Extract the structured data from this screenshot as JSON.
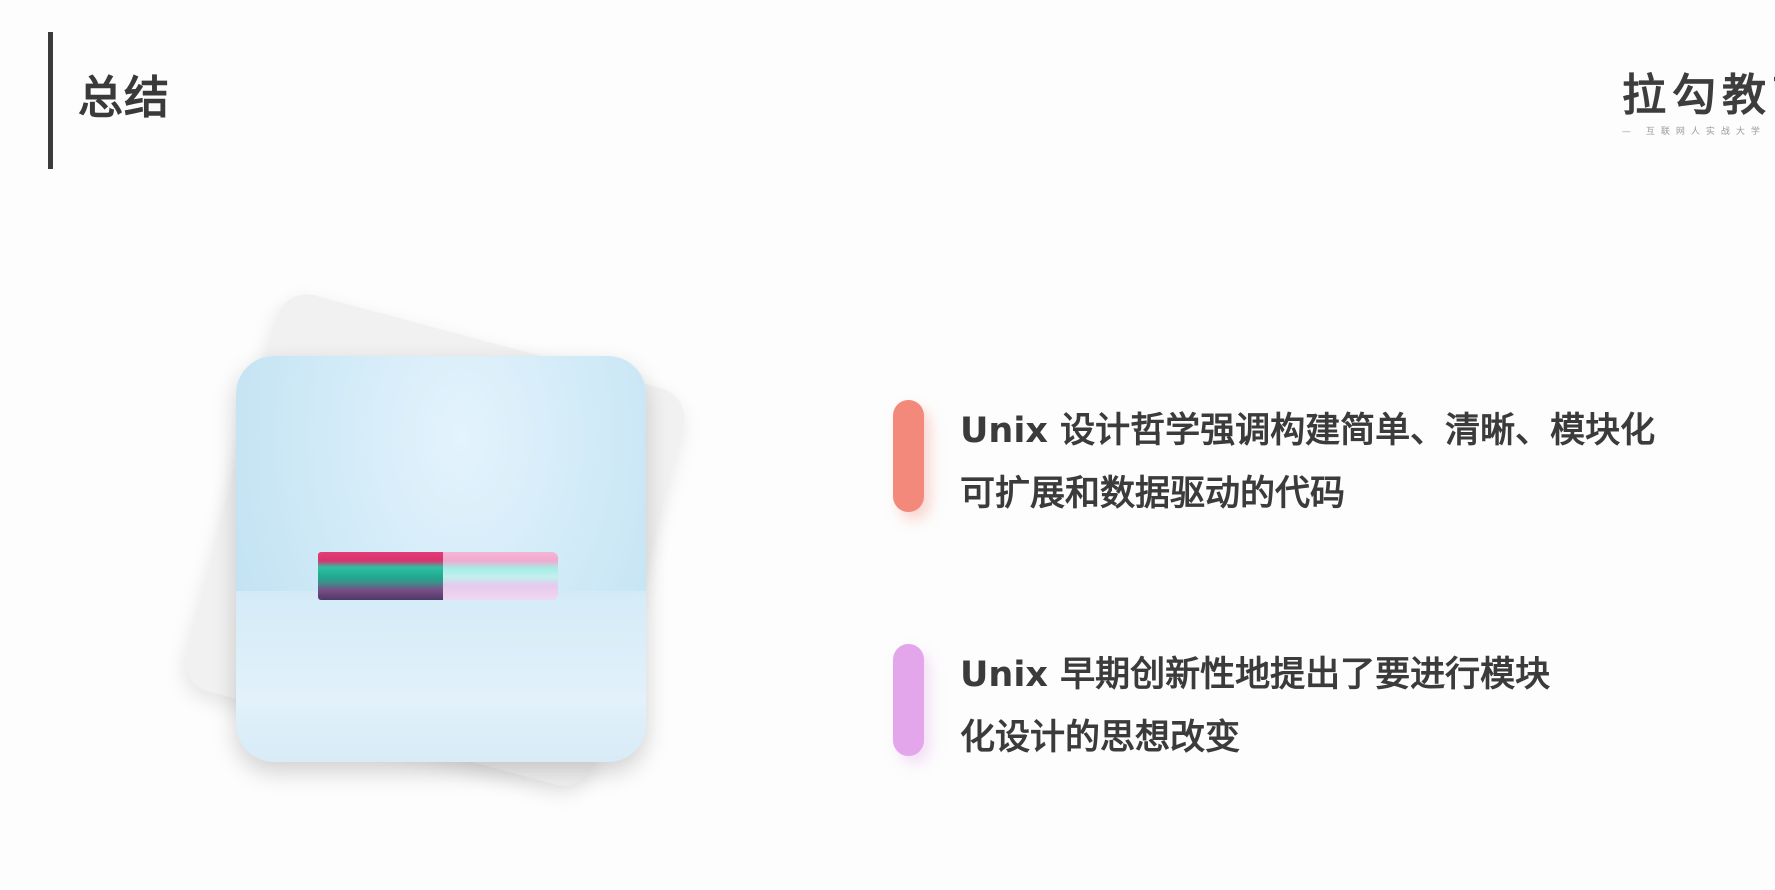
{
  "header": {
    "title": "总结"
  },
  "logo": {
    "main": "拉勾教育",
    "sub": "— 互联网人实战大学"
  },
  "image": {
    "icon": "sticky-notes-photo"
  },
  "points": [
    {
      "accent": "#f2897a",
      "lines": [
        "Unix 设计哲学强调构建简单、清晰、模块化",
        "可扩展和数据驱动的代码"
      ]
    },
    {
      "accent": "#e3a6ea",
      "lines": [
        "Unix 早期创新性地提出了要进行模块",
        "化设计的思想改变"
      ]
    }
  ]
}
